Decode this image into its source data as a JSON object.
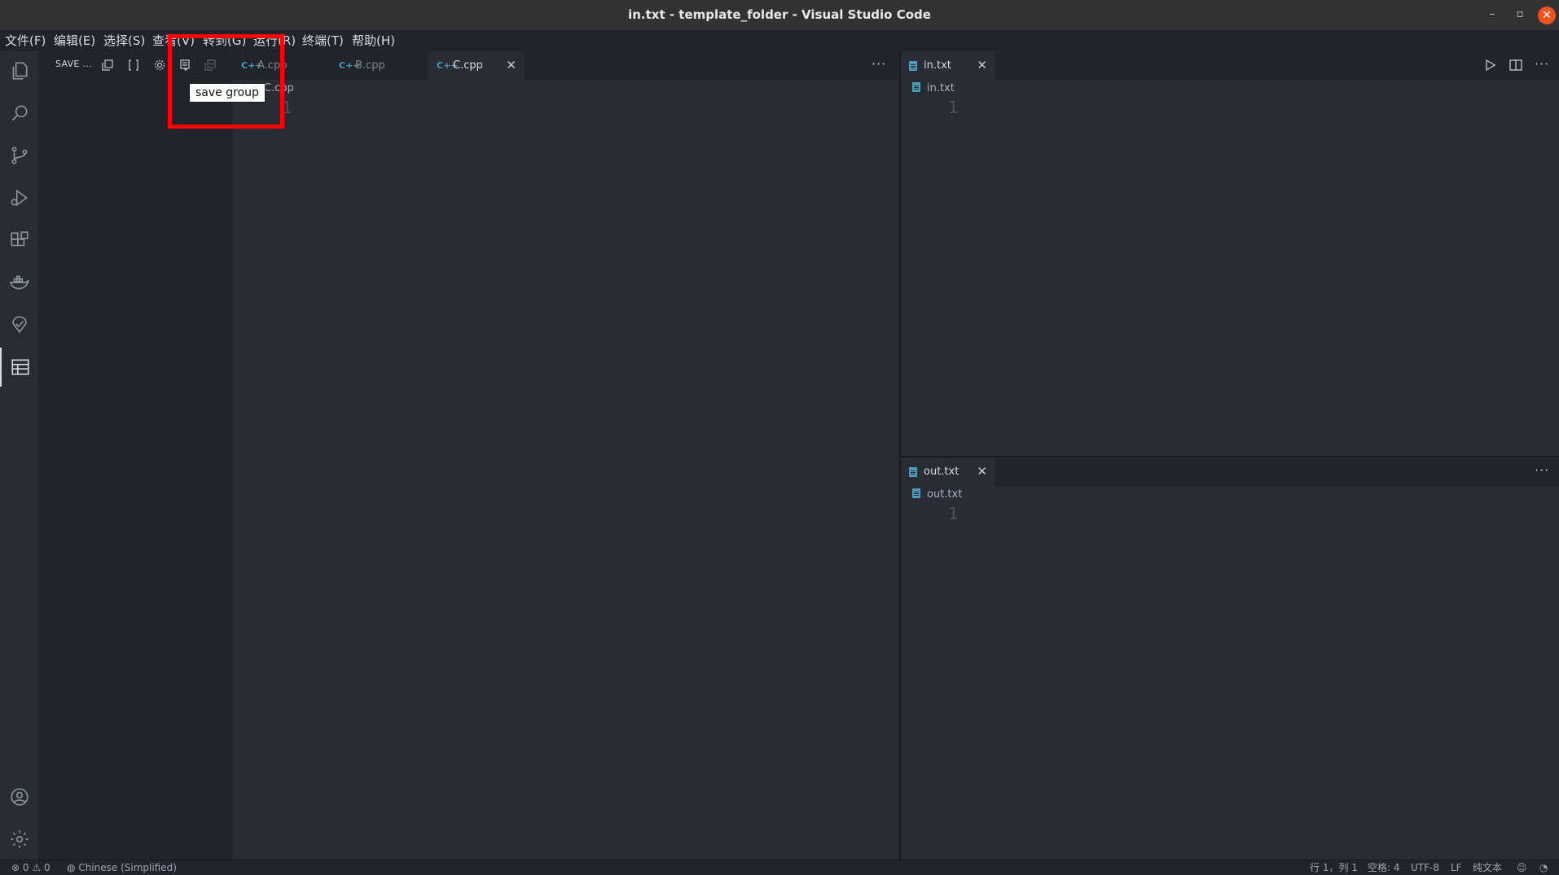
{
  "window": {
    "title": "in.txt - template_folder - Visual Studio Code",
    "minimize": "–",
    "maximize": "▫",
    "close": "✕"
  },
  "menu": [
    "文件(F)",
    "编辑(E)",
    "选择(S)",
    "查看(V)",
    "转到(G)",
    "运行(R)",
    "终端(T)",
    "帮助(H)"
  ],
  "sidebar": {
    "title": "SAVE ...",
    "tooltip": "save group"
  },
  "left_group": {
    "tabs": [
      {
        "icon": "C++",
        "label": "A.cpp",
        "active": false
      },
      {
        "icon": "C++",
        "label": "B.cpp",
        "active": false
      },
      {
        "icon": "C++",
        "label": "C.cpp",
        "active": true,
        "close": "✕"
      }
    ],
    "breadcrumb": "C.cpp",
    "line_number": "1",
    "more": "···"
  },
  "top_right_group": {
    "tab": {
      "label": "in.txt",
      "close": "✕"
    },
    "breadcrumb": "in.txt",
    "line_number": "1",
    "more": "···"
  },
  "bottom_right_group": {
    "tab": {
      "label": "out.txt",
      "close": "✕"
    },
    "breadcrumb": "out.txt",
    "line_number": "1",
    "more": "···"
  },
  "statusbar": {
    "errors": "0",
    "warnings": "0",
    "language_pack": "Chinese (Simplified)",
    "position": "行 1，列 1",
    "spaces": "空格: 4",
    "encoding": "UTF-8",
    "eol": "LF",
    "mode": "纯文本"
  },
  "colors": {
    "editor_bg": "#282c34",
    "sidebar_bg": "#21252b",
    "highlight": "#ff0000",
    "close_button": "#e95420"
  }
}
